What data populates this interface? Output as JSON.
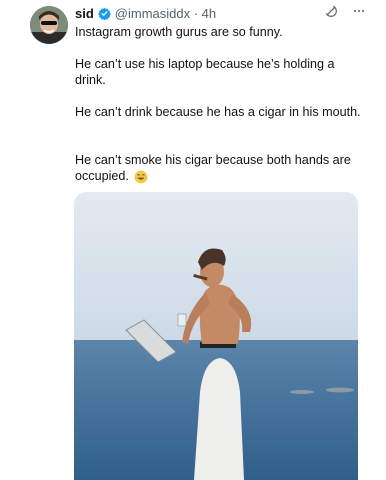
{
  "tweet": {
    "author_name": "sid",
    "handle_time": "@immasiddx · 4h",
    "paragraphs": [
      "Instagram growth gurus are so funny.",
      "He can’t use his laptop because he’s holding a drink.",
      "He can’t drink because he has a cigar in his mouth.",
      "He can’t smoke his cigar because both hands are occupied."
    ],
    "emoji": "laughing-crying-emoji"
  },
  "icons": {
    "verified": "verified-badge-icon",
    "grok": "grok-icon",
    "more": "more-options-icon"
  },
  "colors": {
    "verified": "#1d9bf0",
    "secondary_text": "#536471",
    "sky": "#dfe7ee",
    "sea": "#3d6d96"
  }
}
